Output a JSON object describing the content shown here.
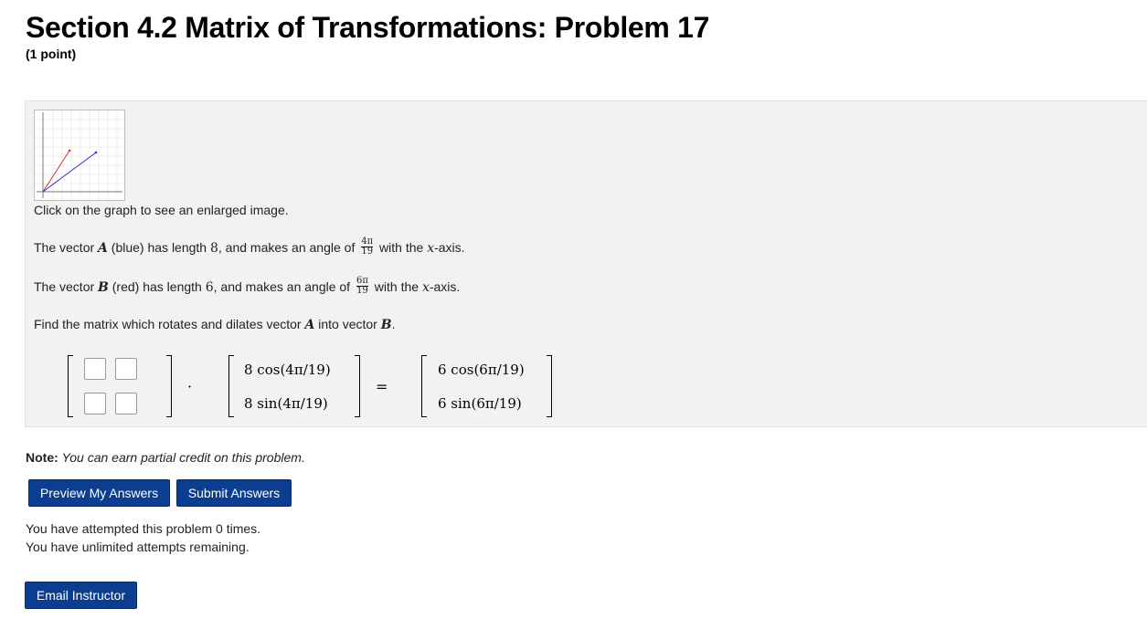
{
  "header": {
    "title": "Section 4.2 Matrix of Transformations: Problem 17",
    "points": "(1 point)"
  },
  "problem": {
    "graph_caption": "Click on the graph to see an enlarged image.",
    "vector_a": {
      "prefix": "The vector ",
      "name": "A",
      "color_word": " (blue) has length ",
      "length": "8",
      "angle_prefix": ", and makes an angle of ",
      "angle_num": "4π",
      "angle_den": "19",
      "suffix_a": " with the ",
      "axis": "x",
      "suffix_b": "-axis."
    },
    "vector_b": {
      "prefix": "The vector ",
      "name": "B",
      "color_word": " (red) has length ",
      "length": "6",
      "angle_prefix": ", and makes an angle of ",
      "angle_num": "6π",
      "angle_den": "19",
      "suffix_a": " with the ",
      "axis": "x",
      "suffix_b": "-axis."
    },
    "instruction": {
      "prefix": "Find the matrix which rotates and dilates vector ",
      "a": "A",
      "middle": " into vector ",
      "b": "B",
      "end": "."
    },
    "equation": {
      "dot": "·",
      "equals": "=",
      "vec_a": [
        "8 cos(4π/19)",
        "8 sin(4π/19)"
      ],
      "vec_b": [
        "6 cos(6π/19)",
        "6 sin(6π/19)"
      ]
    },
    "answers": [
      "",
      "",
      "",
      ""
    ]
  },
  "graph": {
    "blue_color": "#2a2ae6",
    "red_color": "#e62a2a"
  },
  "note": {
    "label": "Note:",
    "text": "You can earn partial credit on this problem."
  },
  "buttons": {
    "preview": "Preview My Answers",
    "submit": "Submit Answers",
    "email": "Email Instructor"
  },
  "status": {
    "attempts": "You have attempted this problem 0 times.",
    "remaining": "You have unlimited attempts remaining."
  },
  "colors": {
    "button_bg": "#0b3d91",
    "panel_bg": "#f2f2f2"
  }
}
